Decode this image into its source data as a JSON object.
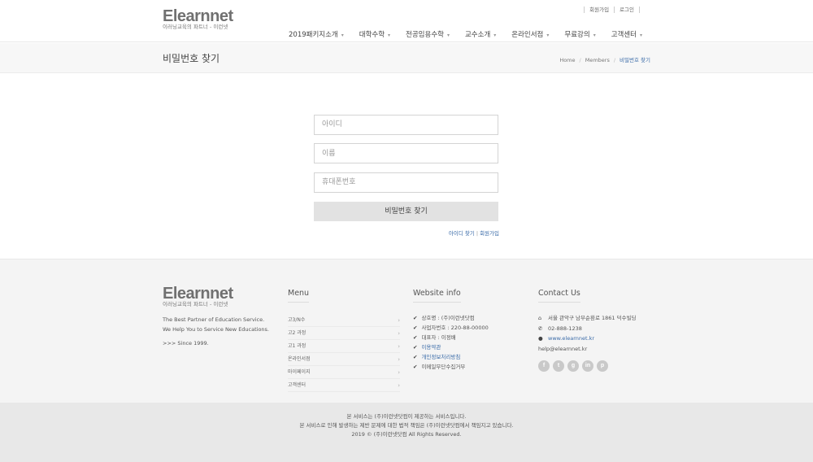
{
  "header": {
    "logo_title": "Elearnnet",
    "logo_sub": "이러닝교육의 파트너 - 이런넷",
    "top_links": [
      "회원가입",
      "로그인"
    ],
    "nav": [
      "2019패키지소개",
      "대학수학",
      "전공임용수학",
      "교수소개",
      "온라인서점",
      "무료강의",
      "고객센터"
    ]
  },
  "titlebar": {
    "title": "비밀번호 찾기",
    "breadcrumb": [
      "Home",
      "Members",
      "비밀번호 찾기"
    ]
  },
  "form": {
    "id_placeholder": "아이디",
    "name_placeholder": "이름",
    "phone_placeholder": "휴대폰번호",
    "submit_label": "비밀번호 찾기",
    "link_find_id": "아이디 찾기",
    "link_signup": "회원가입"
  },
  "footer": {
    "logo_title": "Elearnnet",
    "logo_sub": "이러닝교육의 파트너 - 이런넷",
    "desc_line1": "The Best Partner of Education Service.",
    "desc_line2": "We Help You to Service New Educations.",
    "since": ">>> Since 1999.",
    "menu_heading": "Menu",
    "menu_items": [
      "고3/N수",
      "고2 과정",
      "고1 과정",
      "온라인서점",
      "마이페이지",
      "고객센터"
    ],
    "info_heading": "Website info",
    "info_items": [
      "상호명 : (주)이런넷닷컴",
      "사업자번호 : 220-88-00000",
      "대표자 : 이정배",
      "이용약관",
      "개인정보처리방침",
      "이메일무단수집거부"
    ],
    "contact_heading": "Contact Us",
    "contact_address": "서울 관악구 남부순환로 1861 덕수빌딩",
    "contact_phone": "02-888-1238",
    "contact_web": "www.elearnnet.kr",
    "contact_email": "help@elearnnet.kr"
  },
  "bottom": {
    "line1": "본 서비스는 (주)이런넷닷컴이 제공하는 서비스입니다.",
    "line2": "본 서비스로 인해 발생하는 제반 문제에 대한 법적 책임은 (주)이런넷닷컴에서 책임지고 있습니다.",
    "line3": "2019 © (주)이런넷닷컴 All Rights Reserved."
  },
  "colors": {
    "accent_link": "#3a6ba8",
    "submit_bg": "#e2e2e2"
  }
}
